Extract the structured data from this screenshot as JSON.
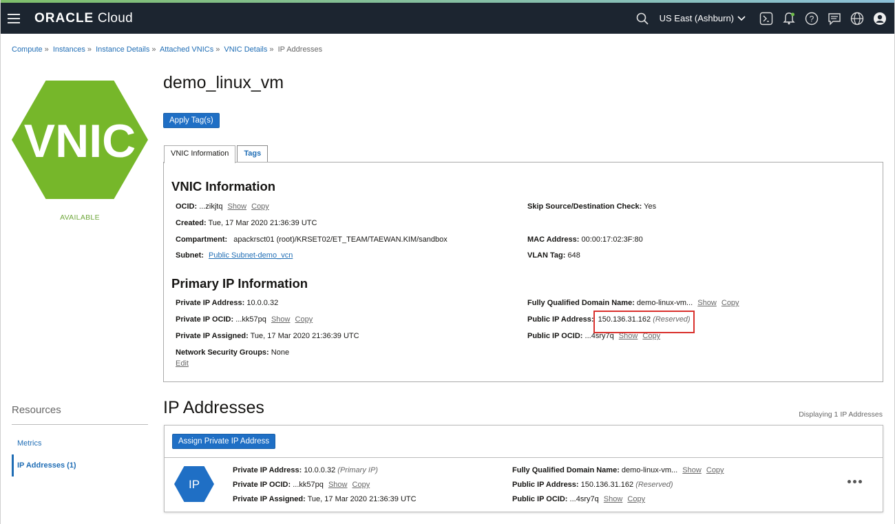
{
  "topbar": {
    "logo_bold": "ORACLE",
    "logo_light": " Cloud",
    "region": "US East (Ashburn)"
  },
  "breadcrumb": [
    "Compute",
    "Instances",
    "Instance Details",
    "Attached VNICs",
    "VNIC Details",
    "IP Addresses"
  ],
  "badge": {
    "text": "VNIC",
    "status": "AVAILABLE",
    "color": "#76b72a",
    "status_color": "#6fa73b"
  },
  "title": "demo_linux_vm",
  "apply_tags_label": "Apply Tag(s)",
  "tabs": [
    "VNIC Information",
    "Tags"
  ],
  "vnic_info": {
    "heading": "VNIC Information",
    "ocid_label": "OCID:",
    "ocid_value": "...zikjtq",
    "created_label": "Created:",
    "created_value": "Tue, 17 Mar 2020 21:36:39 UTC",
    "compartment_label": "Compartment:",
    "compartment_value": "apackrsct01 (root)/KRSET02/ET_TEAM/TAEWAN.KIM/sandbox",
    "subnet_label": "Subnet:",
    "subnet_value": "Public Subnet-demo_vcn",
    "skip_label": "Skip Source/Destination Check:",
    "skip_value": "Yes",
    "mac_label": "MAC Address:",
    "mac_value": "00:00:17:02:3F:80",
    "vlan_label": "VLAN Tag:",
    "vlan_value": "648"
  },
  "primary_ip": {
    "heading": "Primary IP Information",
    "private_ip_label": "Private IP Address:",
    "private_ip_value": "10.0.0.32",
    "private_ocid_label": "Private IP OCID:",
    "private_ocid_value": "...kk57pq",
    "assigned_label": "Private IP Assigned:",
    "assigned_value": "Tue, 17 Mar 2020 21:36:39 UTC",
    "nsg_label": "Network Security Groups:",
    "nsg_value": "None",
    "edit_label": "Edit",
    "fqdn_label": "Fully Qualified Domain Name:",
    "fqdn_value": "demo-linux-vm...",
    "public_ip_label": "Public IP Address:",
    "public_ip_value": "150.136.31.162",
    "reserved": "(Reserved)",
    "public_ocid_label": "Public IP OCID:",
    "public_ocid_value": "...4sry7q"
  },
  "actions": {
    "show": "Show",
    "copy": "Copy"
  },
  "resources": {
    "heading": "Resources",
    "items": [
      "Metrics",
      "IP Addresses (1)"
    ]
  },
  "ip_addresses": {
    "heading": "IP Addresses",
    "displaying": "Displaying 1 IP Addresses",
    "assign_label": "Assign Private IP Address",
    "icon_text": "IP",
    "icon_color": "#1f6fc5",
    "row": {
      "private_ip_label": "Private IP Address:",
      "private_ip_value": "10.0.0.32",
      "primary": "(Primary IP)",
      "private_ocid_label": "Private IP OCID:",
      "private_ocid_value": "...kk57pq",
      "assigned_label": "Private IP Assigned:",
      "assigned_value": "Tue, 17 Mar 2020 21:36:39 UTC",
      "fqdn_label": "Fully Qualified Domain Name:",
      "fqdn_value": "demo-linux-vm...",
      "public_ip_label": "Public IP Address:",
      "public_ip_value": "150.136.31.162",
      "reserved": "(Reserved)",
      "public_ocid_label": "Public IP OCID:",
      "public_ocid_value": "...4sry7q"
    }
  }
}
